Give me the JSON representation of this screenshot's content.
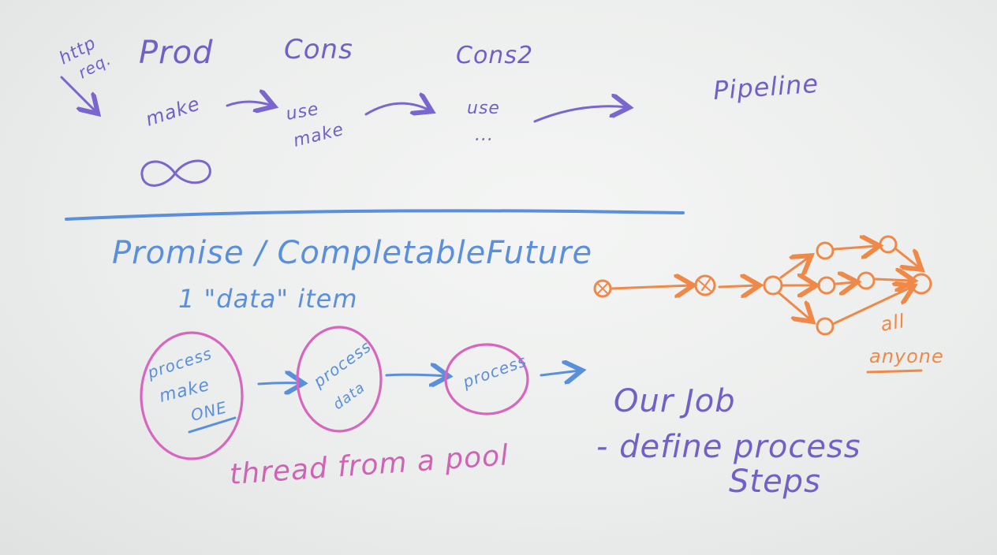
{
  "top": {
    "http_req_line1": "http",
    "http_req_line2": "req.",
    "prod": "Prod",
    "cons": "Cons",
    "cons2": "Cons2",
    "pipeline": "Pipeline",
    "prod_action": "make",
    "cons_action_1": "use",
    "cons_action_2": "make",
    "cons2_action_1": "use",
    "cons2_action_2": "..."
  },
  "bottom": {
    "heading": "Promise / CompletableFuture",
    "subheading": "1 \"data\" item",
    "steps": [
      {
        "lines": [
          "process",
          "make",
          "ONE"
        ]
      },
      {
        "lines": [
          "process",
          "data"
        ]
      },
      {
        "lines": [
          "process"
        ]
      }
    ],
    "thread_note": "thread from a pool",
    "job_line1": "Our Job",
    "job_line2": "- define process",
    "job_line3": "Steps",
    "graph_note_1": "all",
    "graph_note_2": "anyone"
  },
  "colors": {
    "purple": "#7260c8",
    "blue": "#5a8fdc",
    "pink": "#d064b4",
    "orange": "#f08848"
  }
}
